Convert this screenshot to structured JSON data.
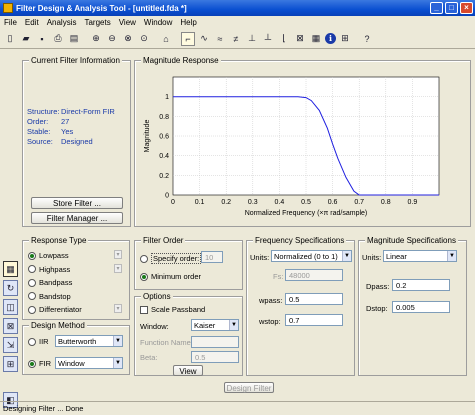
{
  "window": {
    "title": "Filter Design & Analysis Tool - [untitled.fda *]"
  },
  "menu": [
    "File",
    "Edit",
    "Analysis",
    "Targets",
    "View",
    "Window",
    "Help"
  ],
  "toolbar_icons": [
    "new-file-icon",
    "open-folder-icon",
    "save-icon",
    "print-icon",
    "print-preview-icon",
    "sep",
    "zoom-in-icon",
    "zoom-out-icon",
    "zoom-x-icon",
    "zoom-fit-icon",
    "sep",
    "full-view-icon",
    "sep",
    "magnitude-response-icon",
    "phase-response-icon",
    "magnitude-phase-icon",
    "group-delay-icon",
    "phase-delay-icon",
    "impulse-response-icon",
    "step-response-icon",
    "pole-zero-icon",
    "coefficients-icon",
    "info-icon",
    "cost-icon",
    "sep",
    "whats-this-icon"
  ],
  "sidebar_icons": [
    "design-filter-icon",
    "transform-icon",
    "quantize-icon",
    "pole-zero-editor-icon",
    "import-icon",
    "realize-model-icon",
    "multirate-icon"
  ],
  "current_filter": {
    "title": "Current Filter Information",
    "rows": [
      {
        "k": "Structure:",
        "v": "Direct-Form FIR"
      },
      {
        "k": "Order:",
        "v": "27"
      },
      {
        "k": "Stable:",
        "v": "Yes"
      },
      {
        "k": "Source:",
        "v": "Designed"
      }
    ],
    "store_btn": "Store Filter ...",
    "manager_btn": "Filter Manager ..."
  },
  "magnitude": {
    "title": "Magnitude Response"
  },
  "chart_data": {
    "type": "line",
    "title": "",
    "xlabel": "Normalized Frequency (×π rad/sample)",
    "ylabel": "Magnitude",
    "xlim": [
      0,
      1
    ],
    "ylim": [
      0,
      1.2
    ],
    "xticks": [
      "0",
      "0.1",
      "0.2",
      "0.3",
      "0.4",
      "0.5",
      "0.6",
      "0.7",
      "0.8",
      "0.9"
    ],
    "yticks": [
      "0",
      "0.2",
      "0.4",
      "0.6",
      "0.8",
      "1"
    ],
    "grid": true,
    "series": [
      {
        "color": "#2020e0",
        "x": [
          0,
          0.4,
          0.47,
          0.5,
          0.52,
          0.55,
          0.58,
          0.6,
          0.62,
          0.65,
          0.68,
          0.7,
          1.0
        ],
        "y": [
          1,
          1,
          1,
          0.99,
          0.96,
          0.86,
          0.68,
          0.52,
          0.37,
          0.18,
          0.04,
          0,
          0
        ]
      }
    ]
  },
  "response_type": {
    "title": "Response Type",
    "options": [
      "Lowpass",
      "Highpass",
      "Bandpass",
      "Bandstop",
      "Differentiator"
    ],
    "selected": 0
  },
  "design_method": {
    "title": "Design Method",
    "iir_label": "IIR",
    "iir_value": "Butterworth",
    "fir_label": "FIR",
    "fir_value": "Window",
    "selected": "FIR"
  },
  "filter_order": {
    "title": "Filter Order",
    "specify_label": "Specify order:",
    "specify_value": "10",
    "minimum_label": "Minimum order",
    "selected": "minimum"
  },
  "options": {
    "title": "Options",
    "scale_label": "Scale Passband",
    "window_label": "Window:",
    "window_value": "Kaiser",
    "function_label": "Function Name:",
    "beta_label": "Beta:",
    "beta_value": "0.5",
    "view_btn": "View"
  },
  "freq_specs": {
    "title": "Frequency Specifications",
    "units_label": "Units:",
    "units_value": "Normalized (0 to 1)",
    "fs_label": "Fs:",
    "fs_value": "48000",
    "wpass_label": "wpass:",
    "wpass_value": "0.5",
    "wstop_label": "wstop:",
    "wstop_value": "0.7"
  },
  "mag_specs": {
    "title": "Magnitude Specifications",
    "units_label": "Units:",
    "units_value": "Linear",
    "dpass_label": "Dpass:",
    "dpass_value": "0.2",
    "dstop_label": "Dstop:",
    "dstop_value": "0.005"
  },
  "design_btn": "Design Filter",
  "status": "Designing Filter ... Done"
}
